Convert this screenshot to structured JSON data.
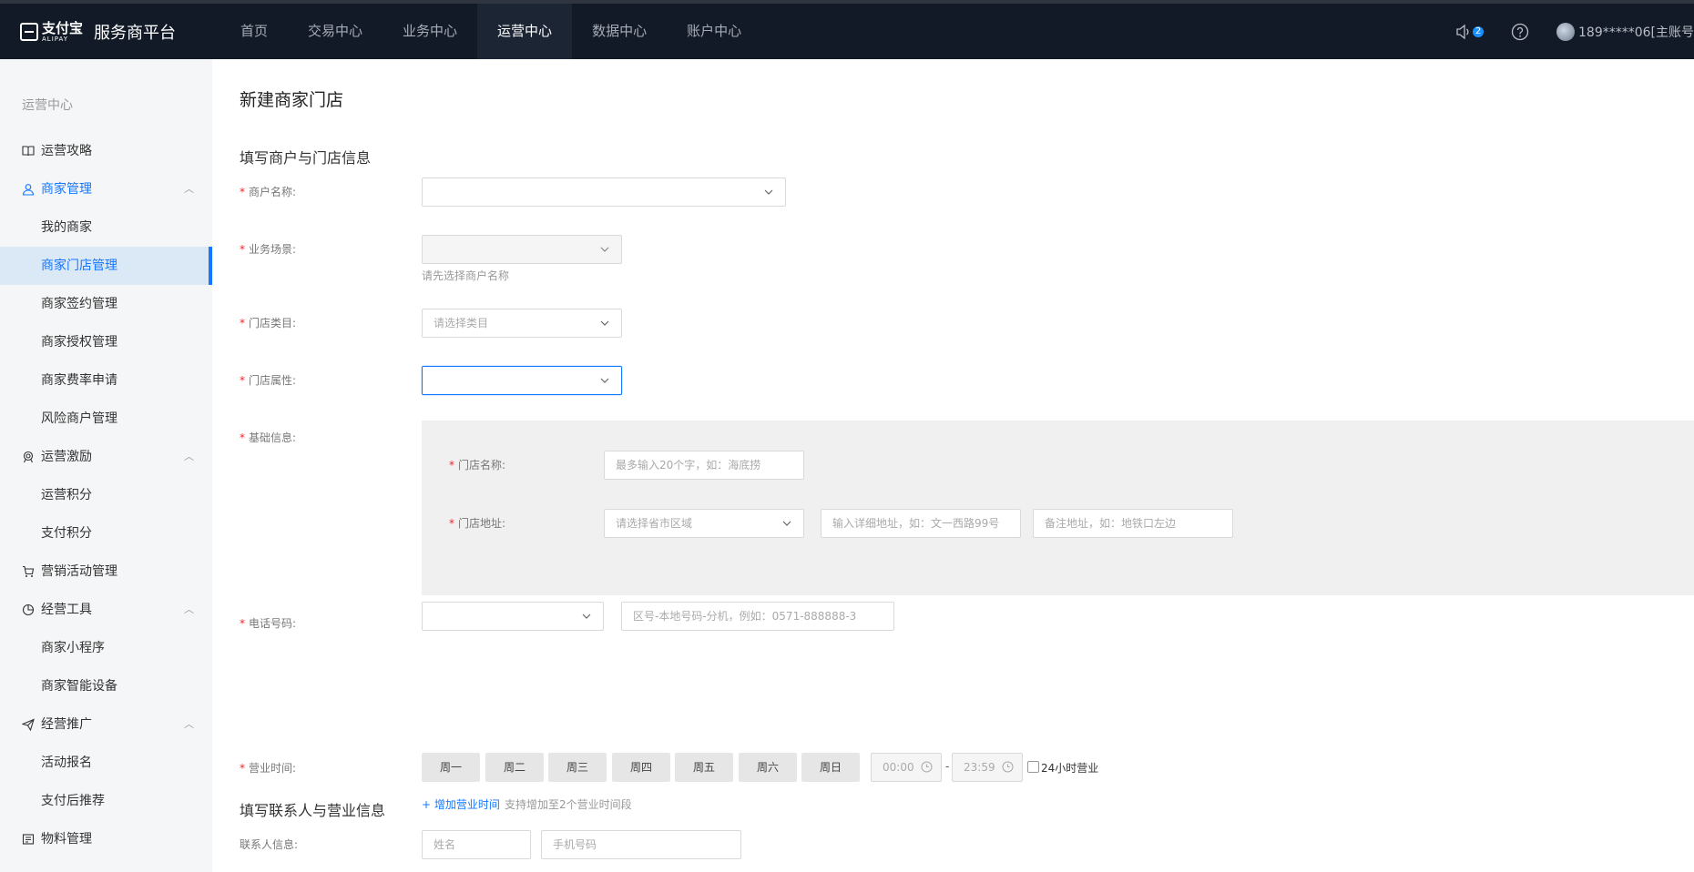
{
  "brand": {
    "logo_text": "支付宝",
    "logo_sub": "ALIPAY",
    "platform": "服务商平台"
  },
  "topnav": [
    {
      "label": "首页"
    },
    {
      "label": "交易中心"
    },
    {
      "label": "业务中心"
    },
    {
      "label": "运营中心"
    },
    {
      "label": "数据中心"
    },
    {
      "label": "账户中心"
    }
  ],
  "topnav_active": "运营中心",
  "header": {
    "notice_count": "2",
    "user": "189*****06[主账号"
  },
  "sidebar": {
    "title": "运营中心",
    "items": [
      {
        "label": "运营攻略",
        "icon": "book-icon"
      },
      {
        "label": "商家管理",
        "icon": "user-icon"
      },
      {
        "label": "我的商家"
      },
      {
        "label": "商家门店管理"
      },
      {
        "label": "商家签约管理"
      },
      {
        "label": "商家授权管理"
      },
      {
        "label": "商家费率申请"
      },
      {
        "label": "风险商户管理"
      },
      {
        "label": "运营激励",
        "icon": "incentive-icon"
      },
      {
        "label": "运营积分"
      },
      {
        "label": "支付积分"
      },
      {
        "label": "营销活动管理",
        "icon": "cart-icon"
      },
      {
        "label": "经营工具",
        "icon": "pie-chart-icon"
      },
      {
        "label": "商家小程序"
      },
      {
        "label": "商家智能设备"
      },
      {
        "label": "经营推广",
        "icon": "send-icon"
      },
      {
        "label": "活动报名"
      },
      {
        "label": "支付后推荐"
      },
      {
        "label": "物料管理",
        "icon": "material-icon"
      }
    ]
  },
  "form": {
    "page_title": "新建商家门店",
    "section1": "填写商户与门店信息",
    "merchant_name": {
      "label": "商户名称:",
      "value": ""
    },
    "business_scene": {
      "label": "业务场景:",
      "value": "",
      "hint": "请先选择商户名称"
    },
    "store_category": {
      "label": "门店类目:",
      "placeholder": "请选择类目"
    },
    "store_attr": {
      "label": "门店属性:",
      "value": ""
    },
    "basic_info": {
      "label": "基础信息:"
    },
    "store_name": {
      "label": "门店名称:",
      "placeholder": "最多输入20个字，如：海底捞"
    },
    "store_address": {
      "label": "门店地址:",
      "region_placeholder": "请选择省市区域",
      "detail_placeholder": "输入详细地址，如：文一西路99号",
      "note_placeholder": "备注地址，如：地铁口左边"
    },
    "phone": {
      "label": "电话号码:",
      "placeholder": "区号-本地号码-分机，例如：0571-888888-3"
    },
    "hours": {
      "label": "营业时间:",
      "days": [
        "周一",
        "周二",
        "周三",
        "周四",
        "周五",
        "周六",
        "周日"
      ],
      "start": "00:00",
      "end": "23:59",
      "separator": "-",
      "allday_label": "24小时营业",
      "add_link": "+ 增加营业时间",
      "add_hint": "支持增加至2个营业时间段"
    },
    "section2": "填写联系人与营业信息",
    "contact": {
      "label": "联系人信息:",
      "name_placeholder": "姓名",
      "phone_placeholder": "手机号码"
    }
  }
}
